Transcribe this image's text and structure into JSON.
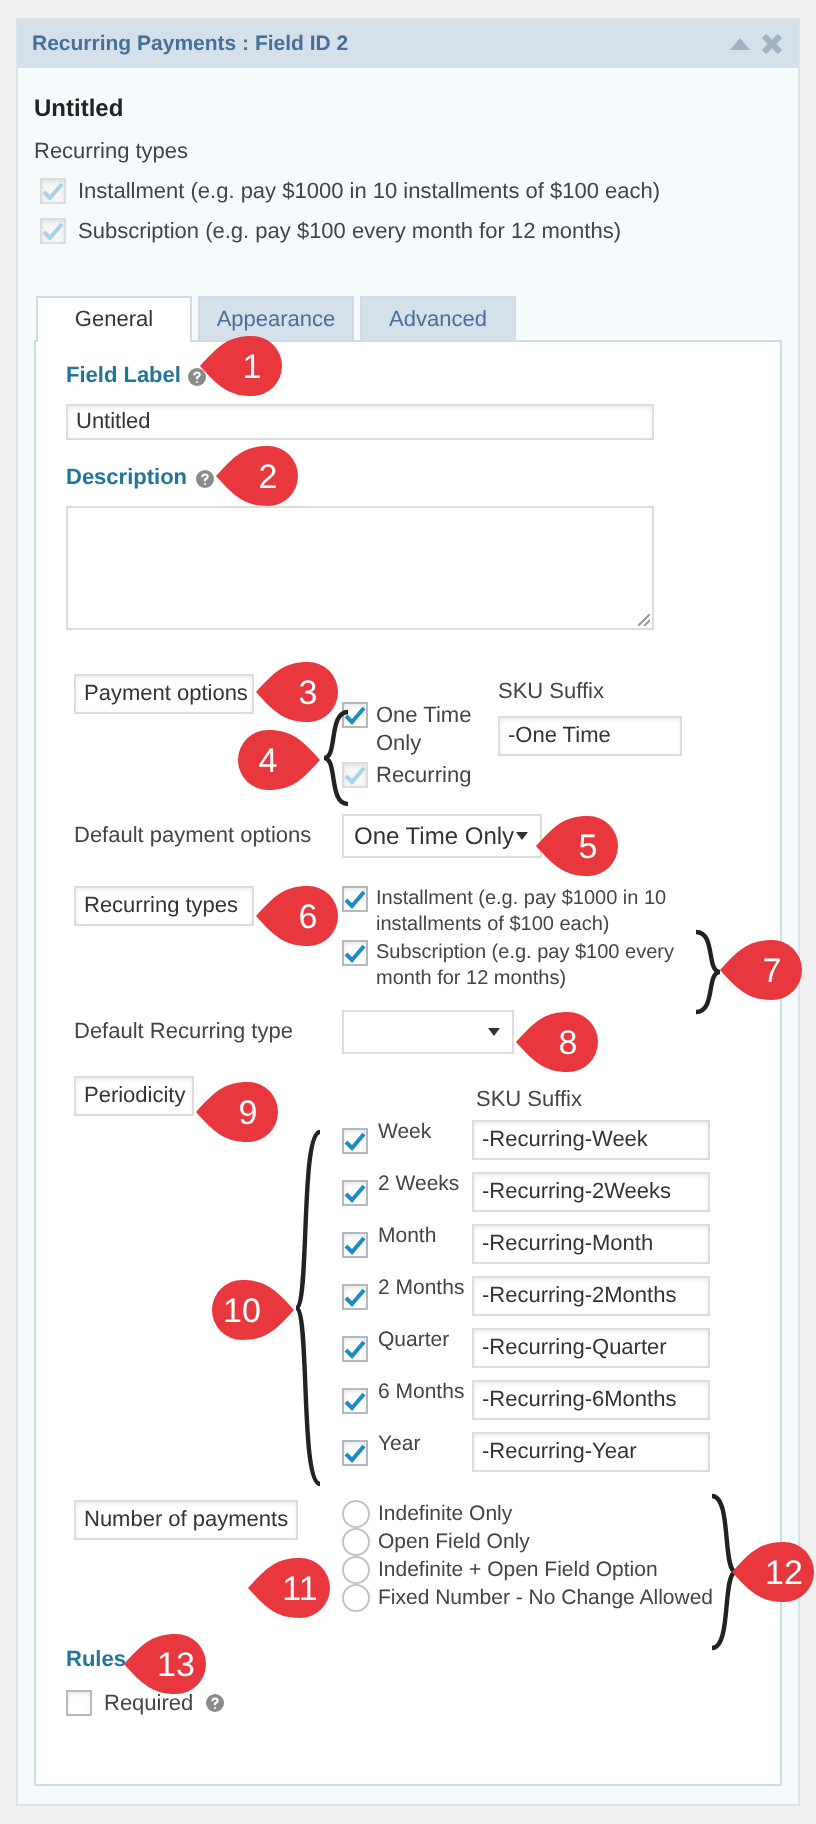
{
  "window": {
    "title": "Recurring Payments : Field ID 2"
  },
  "preview": {
    "title": "Untitled",
    "label": "Recurring types",
    "options": [
      {
        "label": "Installment (e.g. pay $1000 in 10 installments of $100 each)",
        "checked": true,
        "disabled": true
      },
      {
        "label": "Subscription (e.g. pay $100 every month for 12 months)",
        "checked": true,
        "disabled": true
      }
    ]
  },
  "tabs": [
    {
      "label": "General",
      "selected": true
    },
    {
      "label": "Appearance",
      "selected": false
    },
    {
      "label": "Advanced",
      "selected": false
    }
  ],
  "field_label": {
    "label": "Field Label",
    "value": "Untitled"
  },
  "description": {
    "label": "Description"
  },
  "payment_options": {
    "label": "Payment options",
    "sku_header": "SKU Suffix",
    "options": [
      {
        "label": "One Time Only",
        "checked": true,
        "disabled": false,
        "sku": "-One Time"
      },
      {
        "label": "Recurring",
        "checked": true,
        "disabled": true
      }
    ]
  },
  "default_payment": {
    "label": "Default payment options",
    "value": "One Time Only"
  },
  "recurring_types": {
    "label": "Recurring types",
    "options": [
      {
        "label": "Installment (e.g. pay $1000 in 10 installments of $100 each)",
        "checked": true
      },
      {
        "label": "Subscription (e.g. pay $100 every month for 12 months)",
        "checked": true
      }
    ]
  },
  "default_recurring": {
    "label": "Default Recurring type"
  },
  "periodicity": {
    "label": "Periodicity",
    "sku_header": "SKU Suffix",
    "rows": [
      {
        "label": "Week",
        "checked": true,
        "sku": "-Recurring-Week"
      },
      {
        "label": "2 Weeks",
        "checked": true,
        "sku": "-Recurring-2Weeks"
      },
      {
        "label": "Month",
        "checked": true,
        "sku": "-Recurring-Month"
      },
      {
        "label": "2 Months",
        "checked": true,
        "sku": "-Recurring-2Months"
      },
      {
        "label": "Quarter",
        "checked": true,
        "sku": "-Recurring-Quarter"
      },
      {
        "label": "6 Months",
        "checked": true,
        "sku": "-Recurring-6Months"
      },
      {
        "label": "Year",
        "checked": true,
        "sku": "-Recurring-Year"
      }
    ]
  },
  "number_of_payments": {
    "label": "Number of payments",
    "options": [
      {
        "label": "Indefinite Only",
        "selected": false
      },
      {
        "label": "Open Field Only",
        "selected": false
      },
      {
        "label": "Indefinite + Open Field Option",
        "selected": false
      },
      {
        "label": "Fixed Number - No Change Allowed",
        "selected": false
      }
    ]
  },
  "rules": {
    "title": "Rules",
    "options": [
      {
        "label": "Required",
        "checked": false
      }
    ]
  },
  "callouts": [
    {
      "number": "1"
    },
    {
      "number": "2"
    },
    {
      "number": "3"
    },
    {
      "number": "4"
    },
    {
      "number": "5"
    },
    {
      "number": "6"
    },
    {
      "number": "7"
    },
    {
      "number": "8"
    },
    {
      "number": "9"
    },
    {
      "number": "10"
    },
    {
      "number": "11"
    },
    {
      "number": "12"
    },
    {
      "number": "13"
    }
  ]
}
